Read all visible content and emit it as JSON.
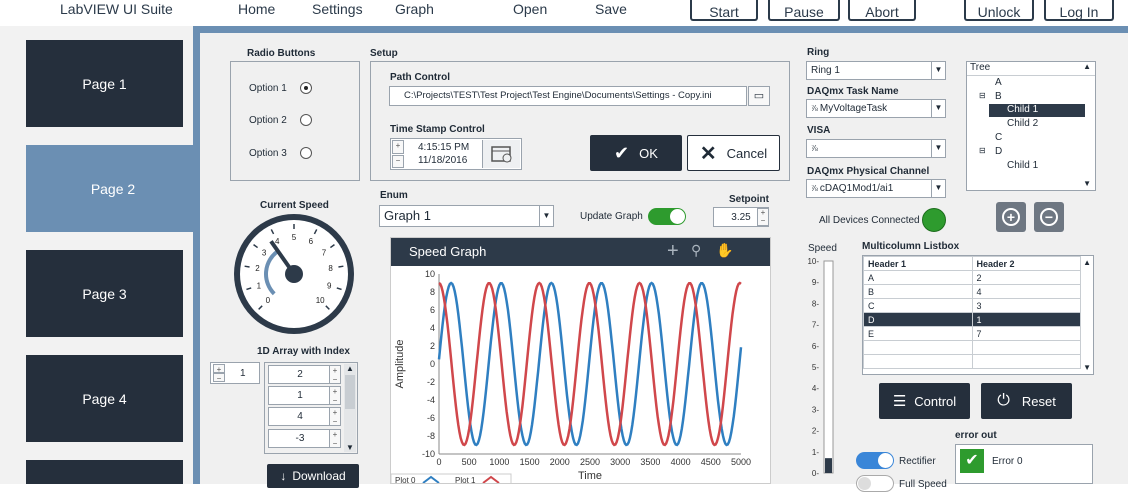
{
  "app": {
    "title": "LabVIEW UI Suite"
  },
  "nav": [
    "Home",
    "Settings",
    "Graph",
    "Open",
    "Save"
  ],
  "toolbar": [
    "Start",
    "Pause",
    "Abort",
    "Unlock",
    "Log In"
  ],
  "pages": [
    "Page 1",
    "Page 2",
    "Page 3",
    "Page 4"
  ],
  "radio": {
    "title": "Radio Buttons",
    "options": [
      "Option 1",
      "Option 2",
      "Option 3"
    ],
    "selected": 0
  },
  "setup": {
    "title": "Setup",
    "path_label": "Path Control",
    "path_value": "C:\\Projects\\TEST\\Test Project\\Test Engine\\Documents\\Settings - Copy.ini",
    "ts_label": "Time Stamp Control",
    "ts_time": "4:15:15 PM",
    "ts_date": "11/18/2016",
    "ok": "OK",
    "cancel": "Cancel"
  },
  "speed": {
    "title": "Current Speed",
    "ticks": [
      "0",
      "1",
      "2",
      "3",
      "4",
      "5",
      "6",
      "7",
      "8",
      "9",
      "10"
    ],
    "value": 3.7
  },
  "enum": {
    "label": "Enum",
    "value": "Graph 1"
  },
  "update": {
    "label": "Update Graph",
    "on": true
  },
  "setpoint": {
    "label": "Setpoint",
    "value": "3.25"
  },
  "array": {
    "label": "1D Array with Index",
    "index": "1",
    "items": [
      "2",
      "1",
      "4",
      "-3"
    ]
  },
  "download": "Download",
  "chart_data": {
    "type": "line",
    "title": "Speed Graph",
    "xlabel": "Time",
    "ylabel": "Amplitude",
    "xlim": [
      0,
      5000
    ],
    "ylim": [
      -10,
      10
    ],
    "xticks": [
      "0",
      "500",
      "1000",
      "1500",
      "2000",
      "2500",
      "3000",
      "3500",
      "4000",
      "4500",
      "5000"
    ],
    "yticks": [
      "10",
      "8",
      "6",
      "4",
      "2",
      "0",
      "-2",
      "-4",
      "-6",
      "-8",
      "-10"
    ],
    "grid": false,
    "series": [
      {
        "name": "Plot 0",
        "color": "#2f7fc1",
        "amplitude": 9,
        "period": 830,
        "phase_shift": 200
      },
      {
        "name": "Plot 1",
        "color": "#d0474b",
        "amplitude": 9,
        "period": 830,
        "phase_shift": 0
      }
    ]
  },
  "ring": {
    "label": "Ring",
    "value": "Ring 1"
  },
  "daqtask": {
    "label": "DAQmx Task Name",
    "value": "MyVoltageTask"
  },
  "visa": {
    "label": "VISA",
    "value": ""
  },
  "daqchan": {
    "label": "DAQmx Physical Channel",
    "value": "cDAQ1Mod1/ai1"
  },
  "devices": {
    "label": "All Devices Connected",
    "color": "#2e9b2e"
  },
  "tree": {
    "header": "Tree",
    "items": [
      {
        "label": "A",
        "level": 0
      },
      {
        "label": "B",
        "level": 0
      },
      {
        "label": "Child 1",
        "level": 1,
        "selected": true
      },
      {
        "label": "Child 2",
        "level": 1
      },
      {
        "label": "C",
        "level": 0
      },
      {
        "label": "D",
        "level": 0
      },
      {
        "label": "Child 1",
        "level": 1
      }
    ]
  },
  "slider": {
    "label": "Speed",
    "ticks": [
      "10",
      "9",
      "8",
      "7",
      "6",
      "5",
      "4",
      "3",
      "2",
      "1",
      "0"
    ],
    "value": 0.7
  },
  "listbox": {
    "title": "Multicolumn Listbox",
    "headers": [
      "Header 1",
      "Header 2"
    ],
    "rows": [
      [
        "A",
        "2"
      ],
      [
        "B",
        "4"
      ],
      [
        "C",
        "3"
      ],
      [
        "D",
        "1"
      ],
      [
        "E",
        "7"
      ],
      [
        "",
        ""
      ],
      [
        "",
        ""
      ]
    ],
    "selected": 3
  },
  "control_btn": "Control",
  "reset_btn": "Reset",
  "rectifier": {
    "label": "Rectifier",
    "on": true
  },
  "fullspeed": {
    "label": "Full Speed",
    "on": false
  },
  "error": {
    "label": "error out",
    "status": "Error 0"
  }
}
